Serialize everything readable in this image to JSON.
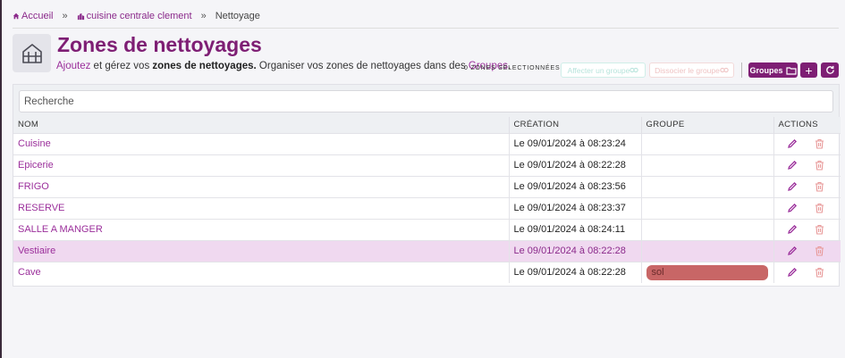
{
  "breadcrumb": {
    "home": "Accueil",
    "site": "cuisine centrale clement",
    "current": "Nettoyage"
  },
  "page": {
    "title": "Zones de nettoyages",
    "subtitle_link1": "Ajoutez",
    "subtitle_text1": " et gérez vos ",
    "subtitle_bold": "zones de nettoyages.",
    "subtitle_text2": " Organiser vos zones de nettoyages dans des ",
    "subtitle_link2": "Groupes",
    "subtitle_end": "."
  },
  "toolbar": {
    "selected_count": "0 ZONES SÉLECTIONNÉES",
    "affect_label": "Affecter un groupe",
    "dissociate_label": "Dissocier le groupe",
    "groups_label": "Groupes",
    "add_label": "+"
  },
  "search": {
    "placeholder": "Recherche"
  },
  "table": {
    "headers": {
      "name": "NOM",
      "created": "CRÉATION",
      "group": "GROUPE",
      "actions": "ACTIONS"
    },
    "rows": [
      {
        "name": "Cuisine",
        "created": "Le 09/01/2024 à 08:23:24",
        "group": ""
      },
      {
        "name": "Epicerie",
        "created": "Le 09/01/2024 à 08:22:28",
        "group": ""
      },
      {
        "name": "FRIGO",
        "created": "Le 09/01/2024 à 08:23:56",
        "group": ""
      },
      {
        "name": "RESERVE",
        "created": "Le 09/01/2024 à 08:23:37",
        "group": ""
      },
      {
        "name": "SALLE A MANGER",
        "created": "Le 09/01/2024 à 08:24:11",
        "group": ""
      },
      {
        "name": "Vestiaire",
        "created": "Le 09/01/2024 à 08:22:28",
        "group": ""
      },
      {
        "name": "Cave",
        "created": "Le 09/01/2024 à 08:22:28",
        "group": "sol"
      }
    ]
  },
  "colors": {
    "brand": "#7e1e74",
    "link": "#9b2f9b",
    "highlight_row": "#f0d9f0",
    "tag_sol": "#c86666",
    "delete_icon": "#e89a9a"
  },
  "icons": [
    "home-icon",
    "building-icon",
    "zones-icon",
    "folder-icon",
    "refresh-icon",
    "pencil-icon",
    "trash-icon"
  ]
}
